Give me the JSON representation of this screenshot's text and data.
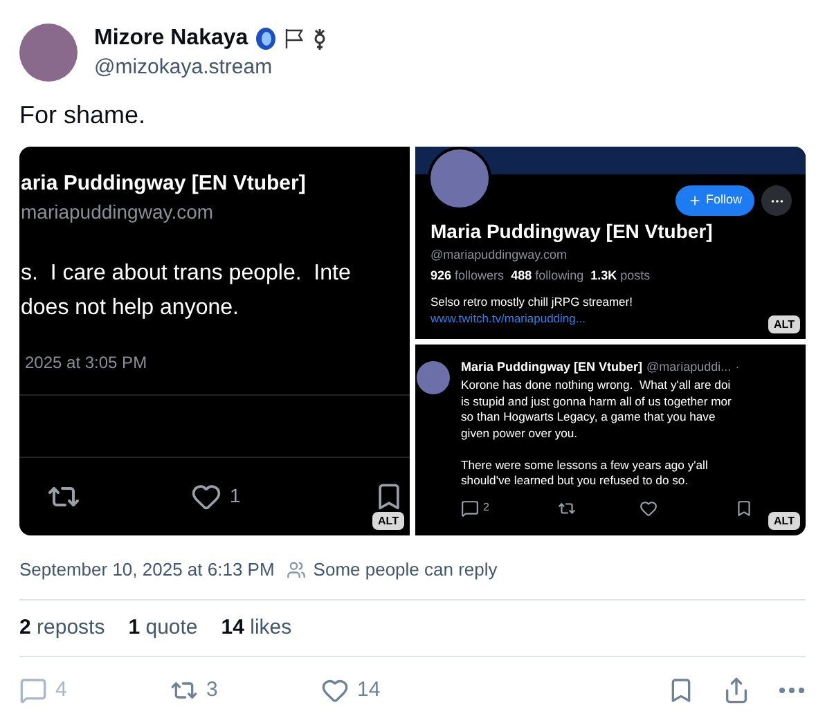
{
  "post": {
    "author": {
      "name": "Mizore Nakaya",
      "handle": "@mizokaya.stream"
    },
    "text": "For shame.",
    "media": [
      {
        "kind": "post",
        "name": "aria Puddingway [EN Vtuber]",
        "handle": "mariapuddingway.com",
        "lines": [
          "s.  I care about trans people.  Inte",
          "does not help anyone."
        ],
        "timestamp": "2025 at 3:05 PM",
        "like_count": "1",
        "alt": "ALT"
      },
      {
        "kind": "profile",
        "name": "Maria Puddingway [EN Vtuber]",
        "handle": "@mariapuddingway.com",
        "follow": "Follow",
        "stats": [
          {
            "count": "926",
            "label": "followers"
          },
          {
            "count": "488",
            "label": "following"
          },
          {
            "count": "1.3K",
            "label": "posts"
          }
        ],
        "bio": "Selso retro mostly chill jRPG streamer!",
        "link": "www.twitch.tv/mariapudding...",
        "alt": "ALT"
      },
      {
        "kind": "reply",
        "name": "Maria Puddingway [EN Vtuber]",
        "handle": "@mariapuddi...",
        "separator": "·",
        "paragraphs": [
          [
            "Korone has done nothing wrong.  What y'all are doi",
            "is stupid and just gonna harm all of us together mor",
            "so than Hogwarts Legacy, a game that you have",
            "given power over you."
          ],
          [
            "There were some lessons a few years ago y'all",
            "should've learned but you refused to do so."
          ]
        ],
        "reply_count": "2",
        "alt": "ALT"
      }
    ],
    "timestamp": "September 10, 2025 at 6:13 PM",
    "reply_setting": "Some people can reply",
    "stats": [
      {
        "count": "2",
        "label": "reposts"
      },
      {
        "count": "1",
        "label": "quote"
      },
      {
        "count": "14",
        "label": "likes"
      }
    ],
    "actions": [
      {
        "kind": "reply",
        "count": "4"
      },
      {
        "kind": "repost",
        "count": "3"
      },
      {
        "kind": "like",
        "count": "14"
      },
      {
        "kind": "bookmark"
      },
      {
        "kind": "share"
      },
      {
        "kind": "more"
      }
    ]
  }
}
